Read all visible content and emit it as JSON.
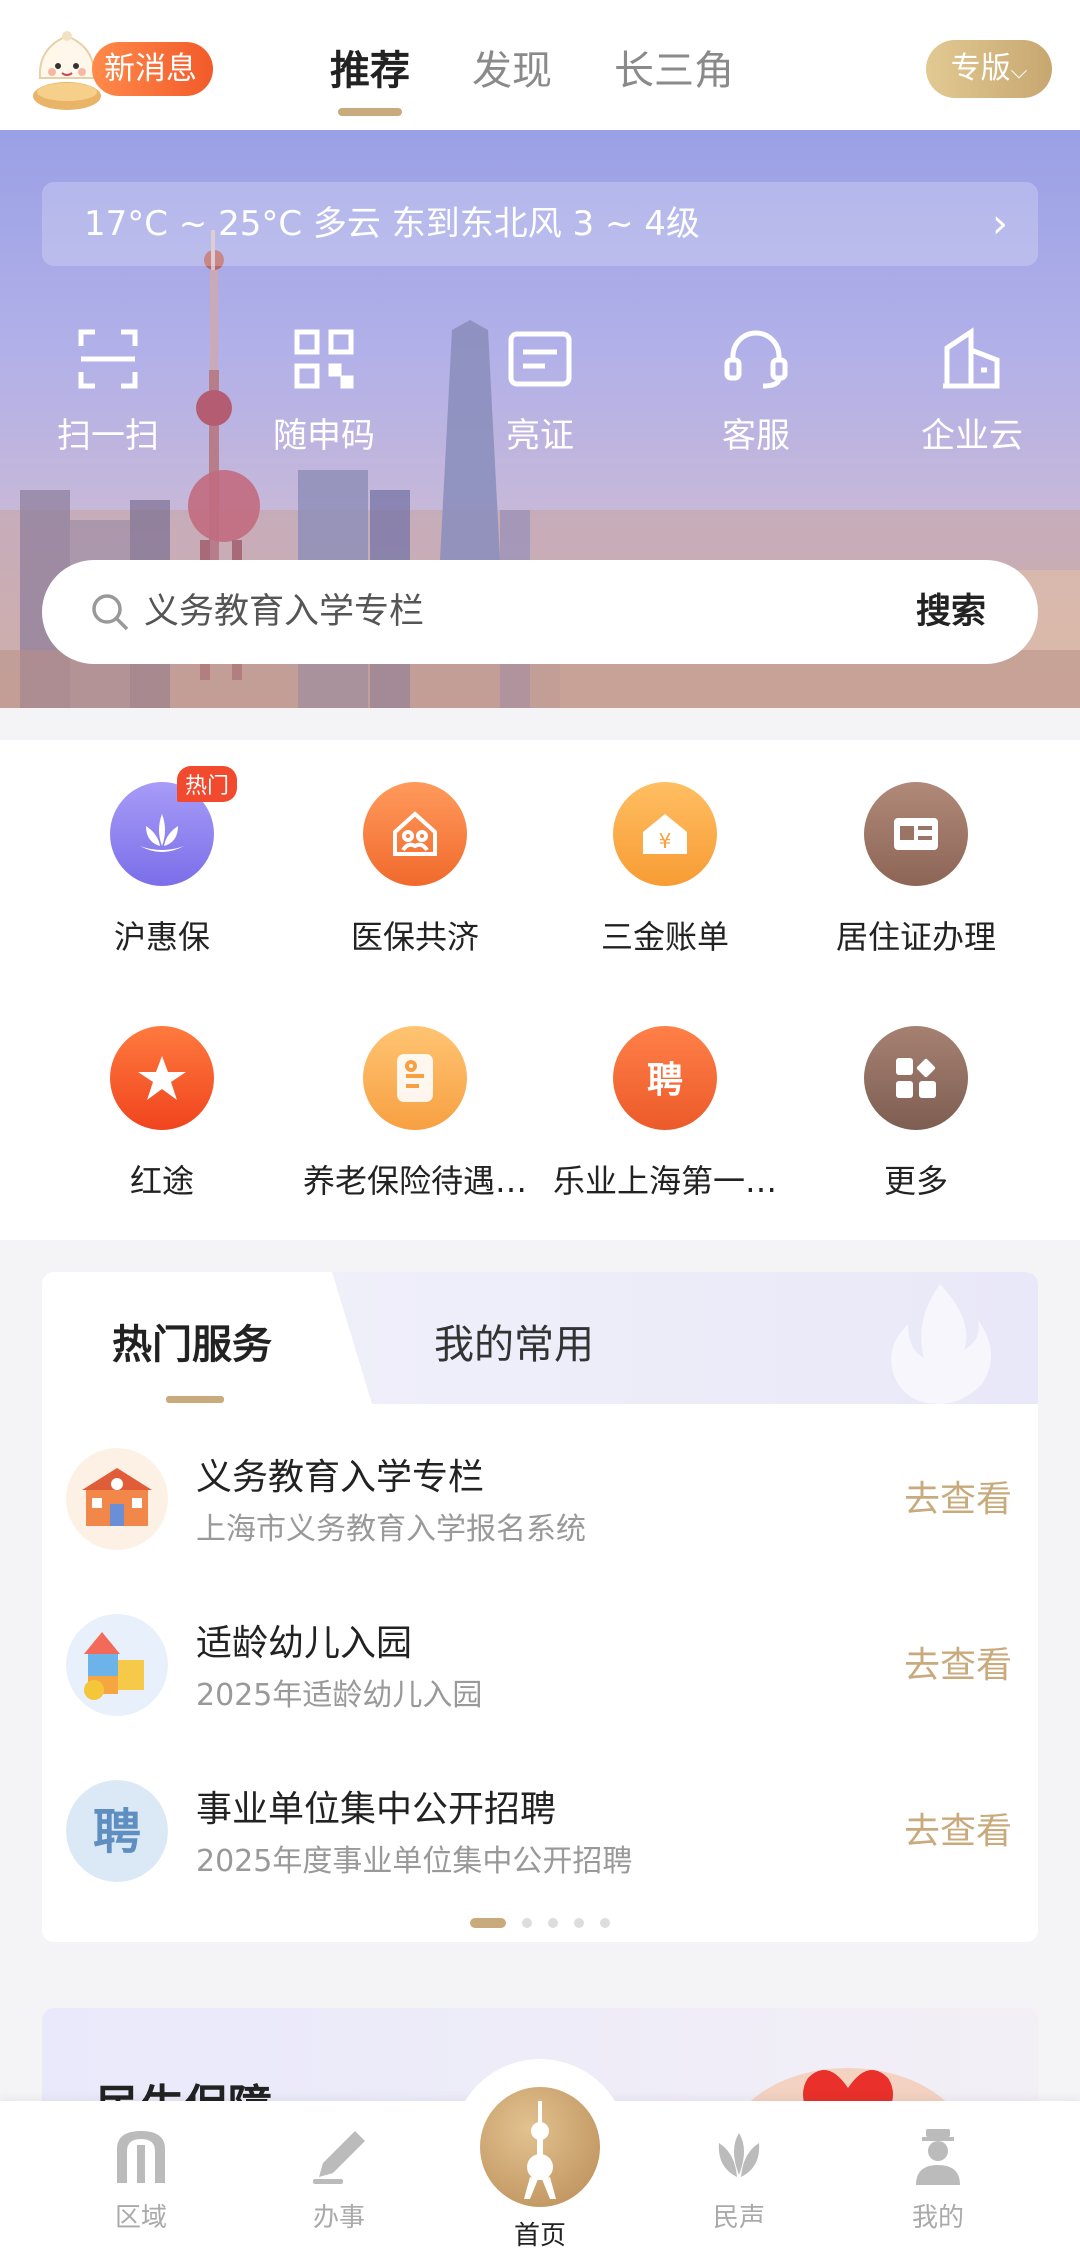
{
  "header": {
    "new_message": "新消息",
    "tabs": [
      {
        "label": "推荐",
        "active": true
      },
      {
        "label": "发现",
        "active": false
      },
      {
        "label": "长三角",
        "active": false
      }
    ],
    "edition": "专版"
  },
  "weather": {
    "text": "17°C ~ 25°C  多云  东到东北风  3 ~ 4级"
  },
  "quick_actions": [
    {
      "label": "扫一扫",
      "icon": "scan-icon"
    },
    {
      "label": "随申码",
      "icon": "qr-code-icon"
    },
    {
      "label": "亮证",
      "icon": "id-card-icon"
    },
    {
      "label": "客服",
      "icon": "headset-icon"
    },
    {
      "label": "企业云",
      "icon": "building-icon"
    }
  ],
  "search": {
    "placeholder": "义务教育入学专栏",
    "button": "搜索"
  },
  "services": [
    {
      "label": "沪惠保",
      "icon": "lotus-icon",
      "badge": "热门",
      "color": "#8b7ff0"
    },
    {
      "label": "医保共济",
      "icon": "family-home-icon",
      "color": "#f4793b"
    },
    {
      "label": "三金账单",
      "icon": "yuan-house-icon",
      "color": "#f8a646"
    },
    {
      "label": "居住证办理",
      "icon": "residence-card-icon",
      "color": "#9c7567"
    },
    {
      "label": "红途",
      "icon": "red-star-icon",
      "color": "#f5562a"
    },
    {
      "label": "养老保险待遇…",
      "icon": "pension-doc-icon",
      "color": "#f7aa4e"
    },
    {
      "label": "乐业上海第一…",
      "icon": "hire-icon",
      "color": "#f0683a"
    },
    {
      "label": "更多",
      "icon": "more-grid-icon",
      "color": "#8d6f64"
    }
  ],
  "hot_services": {
    "tabs": [
      "热门服务",
      "我的常用"
    ],
    "items": [
      {
        "title": "义务教育入学专栏",
        "subtitle": "上海市义务教育入学报名系统",
        "action": "去查看",
        "icon": "school-icon"
      },
      {
        "title": "适龄幼儿入园",
        "subtitle": "2025年适龄幼儿入园",
        "action": "去查看",
        "icon": "toy-blocks-icon"
      },
      {
        "title": "事业单位集中公开招聘",
        "subtitle": "2025年度事业单位集中公开招聘",
        "action": "去查看",
        "icon": "hire-badge-icon"
      }
    ],
    "page_count": 5,
    "current_page": 1
  },
  "promo": {
    "title": "民生保障"
  },
  "tabbar": [
    {
      "label": "区域",
      "icon": "arch-icon"
    },
    {
      "label": "办事",
      "icon": "pen-icon"
    },
    {
      "label": "首页",
      "icon": "tower-icon",
      "active": true
    },
    {
      "label": "民声",
      "icon": "magnolia-icon"
    },
    {
      "label": "我的",
      "icon": "person-icon"
    }
  ]
}
